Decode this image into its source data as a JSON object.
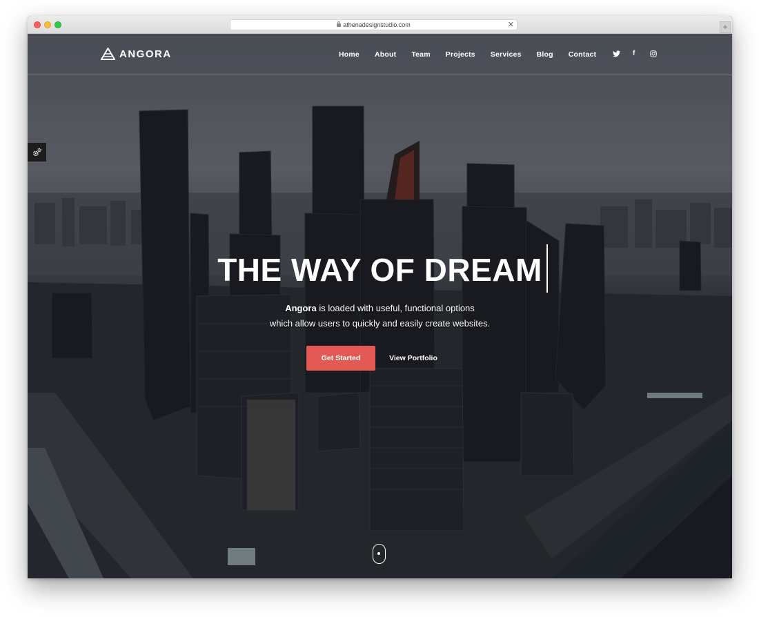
{
  "browser": {
    "url": "athenadesignstudio.com",
    "close_glyph": "✕",
    "new_tab_glyph": "+"
  },
  "site": {
    "logo_text": "ANGORA",
    "nav_items": [
      "Home",
      "About",
      "Team",
      "Projects",
      "Services",
      "Blog",
      "Contact"
    ],
    "social_icons": [
      "twitter-icon",
      "facebook-icon",
      "instagram-icon"
    ],
    "social_glyphs": [
      "🐦",
      "f",
      "◎"
    ]
  },
  "hero": {
    "headline": "THE WAY OF DREAM",
    "subline_bold": "Angora",
    "subline_rest": " is loaded with useful, functional options",
    "subline_line2": "which allow users to quickly and easily create websites.",
    "primary_button": "Get Started",
    "secondary_button": "View Portfolio"
  },
  "colors": {
    "accent": "#e35a54",
    "nav_text": "#ffffff",
    "settings_bg": "#1c1c1c"
  }
}
